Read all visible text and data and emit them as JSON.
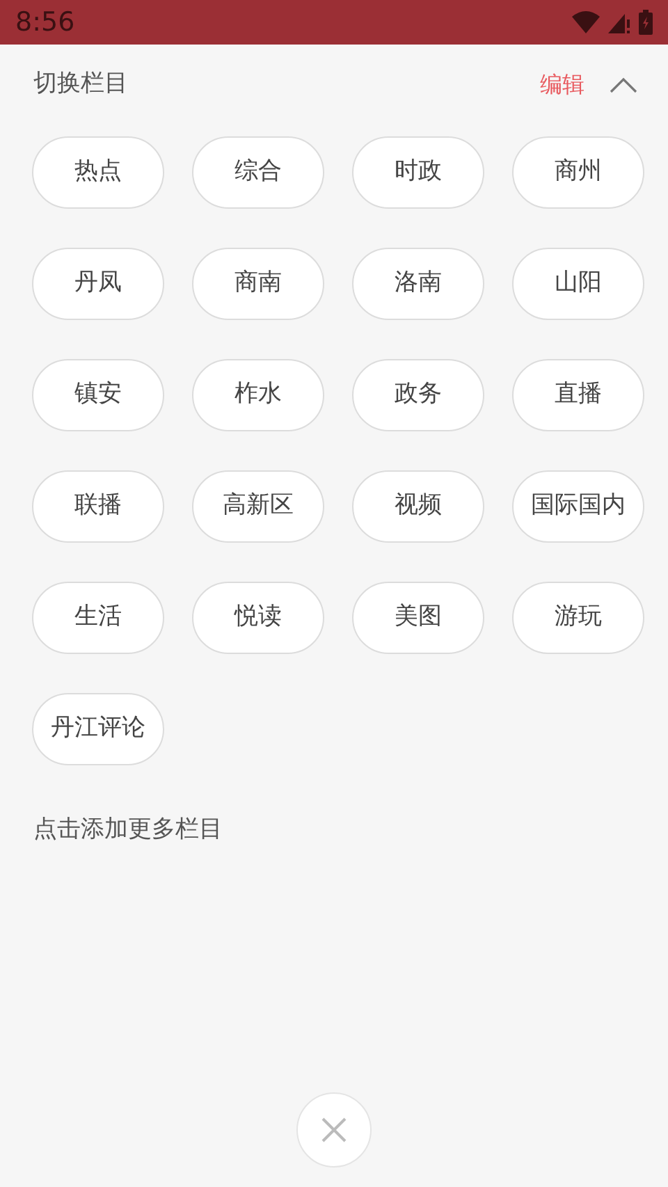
{
  "status_bar": {
    "time": "8:56"
  },
  "header": {
    "title": "切换栏目",
    "edit": "编辑"
  },
  "channels": [
    "热点",
    "综合",
    "时政",
    "商州",
    "丹凤",
    "商南",
    "洛南",
    "山阳",
    "镇安",
    "柞水",
    "政务",
    "直播",
    "联播",
    "高新区",
    "视频",
    "国际国内",
    "生活",
    "悦读",
    "美图",
    "游玩",
    "丹江评论"
  ],
  "more_hint": "点击添加更多栏目"
}
